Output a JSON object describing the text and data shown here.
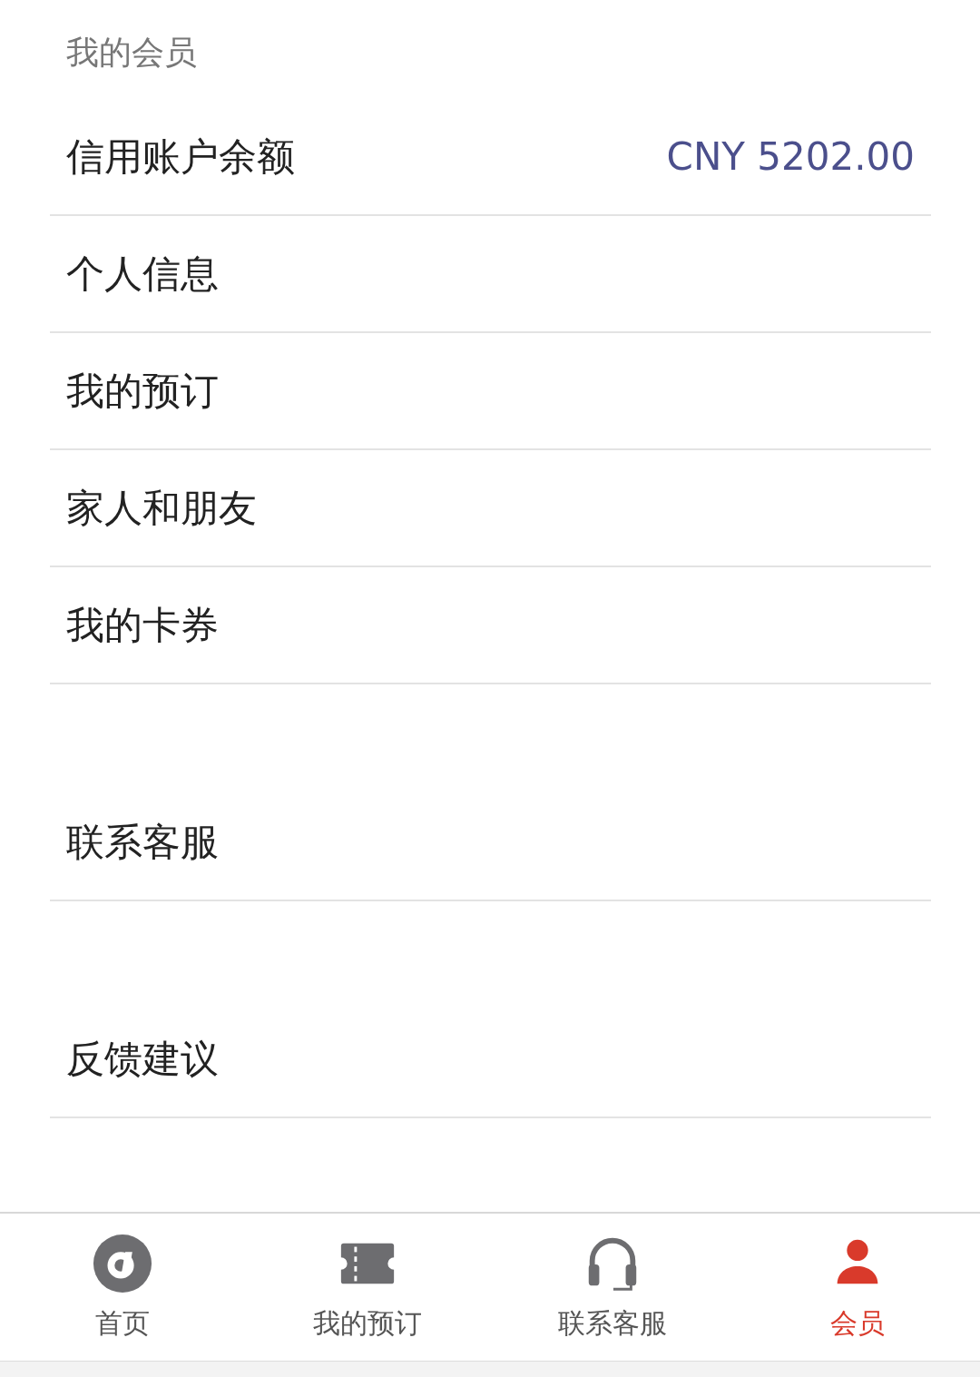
{
  "section_title": "我的会员",
  "groups": [
    {
      "items": [
        {
          "kind": "balance",
          "label": "信用账户余额",
          "value": "CNY 5202.00"
        },
        {
          "kind": "link",
          "label": "个人信息"
        },
        {
          "kind": "link",
          "label": "我的预订"
        },
        {
          "kind": "link",
          "label": "家人和朋友"
        },
        {
          "kind": "link",
          "label": "我的卡券"
        }
      ]
    },
    {
      "items": [
        {
          "kind": "link",
          "label": "联系客服"
        }
      ]
    },
    {
      "items": [
        {
          "kind": "link",
          "label": "反馈建议"
        }
      ]
    }
  ],
  "tab_bar": [
    {
      "kind": "logo",
      "label": "首页",
      "selected": false
    },
    {
      "kind": "ticket",
      "label": "我的预订",
      "selected": false
    },
    {
      "kind": "headset",
      "label": "联系客服",
      "selected": false
    },
    {
      "kind": "person",
      "label": "会员",
      "selected": true
    }
  ]
}
